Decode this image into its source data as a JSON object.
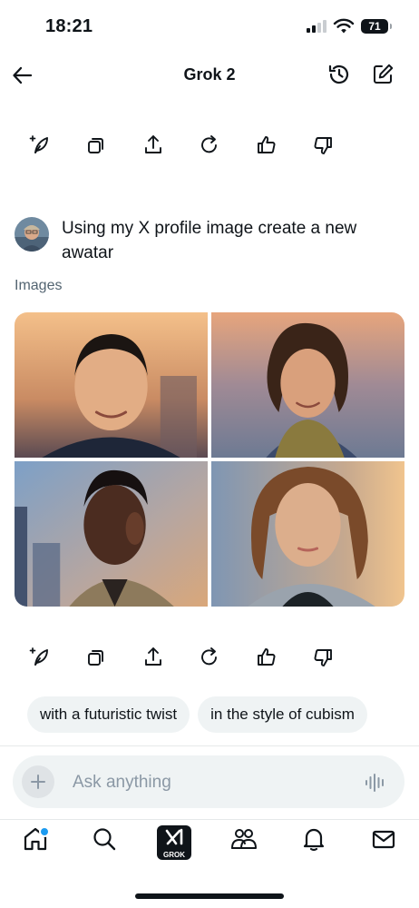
{
  "status": {
    "time": "18:21",
    "battery": "71"
  },
  "header": {
    "title": "Grok 2"
  },
  "icons": {
    "back": "arrow-left-icon",
    "history": "history-icon",
    "new_chat": "compose-icon",
    "regenerate_style": "sparkle-pen-icon",
    "copy": "copy-icon",
    "share": "share-icon",
    "refresh": "refresh-icon",
    "like": "thumbs-up-icon",
    "dislike": "thumbs-down-icon"
  },
  "message": {
    "text": "Using my X profile image create a new awatar"
  },
  "results": {
    "label": "Images",
    "images": [
      "portrait-smiling-man-sunset",
      "portrait-long-hair-man-knit",
      "portrait-man-patterned-jacket",
      "portrait-woman-bob-hair"
    ]
  },
  "suggestions": [
    "with a futuristic twist",
    "in the style of cubism"
  ],
  "composer": {
    "placeholder": "Ask anything"
  },
  "bottom_nav": {
    "items": [
      "home",
      "search",
      "grok",
      "communities",
      "notifications",
      "messages"
    ],
    "grok_label": "GROK"
  },
  "colors": {
    "accent": "#1d9bf0",
    "text": "#0f1419",
    "muted": "#536471",
    "surface": "#eff3f4"
  }
}
